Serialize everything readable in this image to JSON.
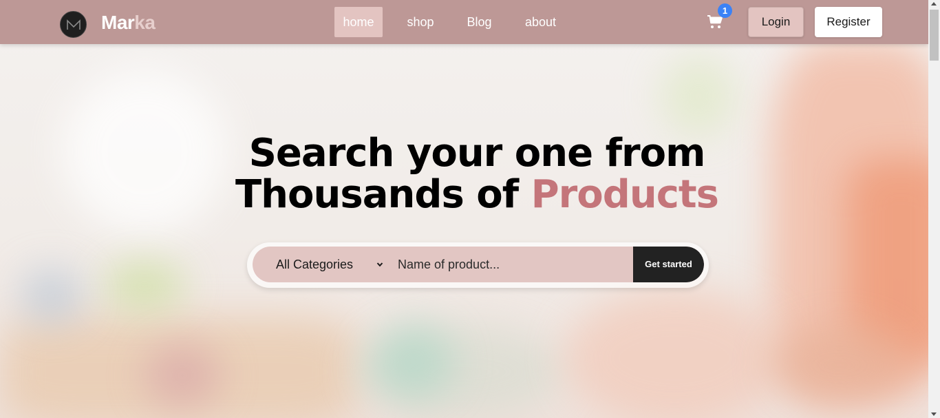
{
  "brand": {
    "name_part1": "Mar",
    "name_part2": "ka",
    "logo_letter": "M"
  },
  "nav": {
    "links": [
      {
        "label": "home",
        "active": true
      },
      {
        "label": "shop",
        "active": false
      },
      {
        "label": "Blog",
        "active": false
      },
      {
        "label": "about",
        "active": false
      }
    ]
  },
  "cart": {
    "icon": "shopping-cart-icon",
    "count": "1"
  },
  "auth": {
    "login_label": "Login",
    "register_label": "Register"
  },
  "hero": {
    "title_line1": "Search your one from",
    "title_line2_plain": "Thousands of ",
    "title_line2_accent": "Products"
  },
  "search": {
    "category_selected": "All Categories",
    "input_placeholder": "Name of product...",
    "submit_label": "Get started"
  },
  "colors": {
    "navbar": "#bd9896",
    "nav_active": "#e3c4c1",
    "accent": "#c4757a",
    "search_bg": "#e2c6c3",
    "button_dark": "#222222",
    "badge": "#3b82f6"
  }
}
